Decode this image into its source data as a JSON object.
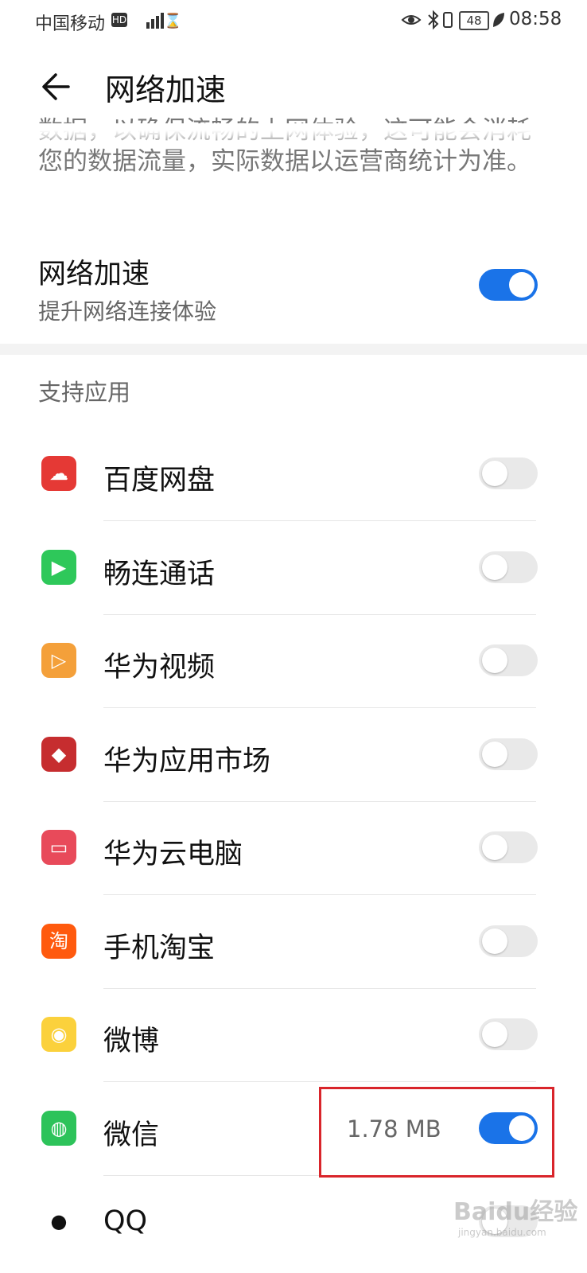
{
  "status_bar": {
    "carrier": "中国移动",
    "hd": "HD",
    "battery": "48",
    "time": "08:58"
  },
  "header": {
    "title": "网络加速"
  },
  "description": "数据，以确保流畅的上网体验，这可能会消耗您的数据流量，实际数据以运营商统计为准。",
  "master": {
    "title": "网络加速",
    "subtitle": "提升网络连接体验",
    "enabled": true
  },
  "section_title": "支持应用",
  "apps": [
    {
      "name": "百度网盘",
      "icon": "baidu-netdisk-icon",
      "color": "#e53935",
      "enabled": false,
      "usage": ""
    },
    {
      "name": "畅连通话",
      "icon": "meetime-icon",
      "color": "#2ec85a",
      "enabled": false,
      "usage": ""
    },
    {
      "name": "华为视频",
      "icon": "huawei-video-icon",
      "color": "#f4a03a",
      "enabled": false,
      "usage": ""
    },
    {
      "name": "华为应用市场",
      "icon": "huawei-appgallery-icon",
      "color": "#c62d2f",
      "enabled": false,
      "usage": ""
    },
    {
      "name": "华为云电脑",
      "icon": "huawei-cloud-pc-icon",
      "color": "#e84a5a",
      "enabled": false,
      "usage": ""
    },
    {
      "name": "手机淘宝",
      "icon": "taobao-icon",
      "color": "#ff5a0e",
      "enabled": false,
      "usage": ""
    },
    {
      "name": "微博",
      "icon": "weibo-icon",
      "color": "#fbd13c",
      "enabled": false,
      "usage": ""
    },
    {
      "name": "微信",
      "icon": "wechat-icon",
      "color": "#2dc35a",
      "enabled": true,
      "usage": "1.78 MB"
    },
    {
      "name": "QQ",
      "icon": "qq-icon",
      "color": "#111111",
      "enabled": false,
      "usage": ""
    }
  ],
  "watermark": {
    "brand": "Baidu经验",
    "site": "jingyan.baidu.com"
  },
  "colors": {
    "accent": "#1a73e8",
    "toggle_off": "#e9e9e9",
    "highlight": "#d9252b"
  }
}
